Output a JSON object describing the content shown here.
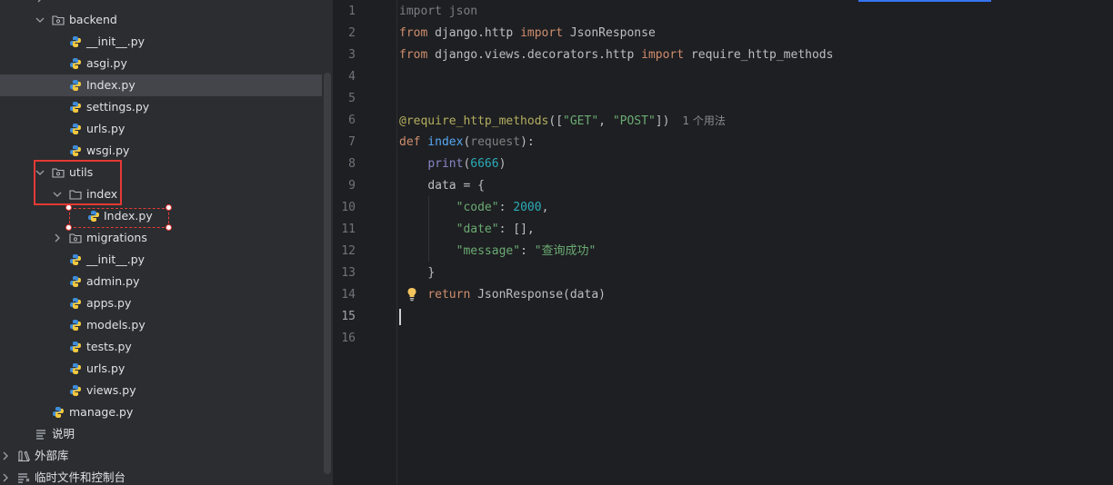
{
  "tree": {
    "items": [
      {
        "label": "backend",
        "icon": "folder-package-icon",
        "expanded": true
      },
      {
        "label": "__init__.py",
        "icon": "python-icon"
      },
      {
        "label": "asgi.py",
        "icon": "python-icon"
      },
      {
        "label": "Index.py",
        "icon": "python-icon",
        "selected": true
      },
      {
        "label": "settings.py",
        "icon": "python-icon"
      },
      {
        "label": "urls.py",
        "icon": "python-icon"
      },
      {
        "label": "wsgi.py",
        "icon": "python-icon"
      },
      {
        "label": "utils",
        "icon": "folder-package-icon",
        "expanded": true
      },
      {
        "label": "index",
        "icon": "folder-icon",
        "expanded": true
      },
      {
        "label": "Index.py",
        "icon": "python-icon"
      },
      {
        "label": "migrations",
        "icon": "folder-package-icon",
        "expanded": false
      },
      {
        "label": "__init__.py",
        "icon": "python-icon"
      },
      {
        "label": "admin.py",
        "icon": "python-icon"
      },
      {
        "label": "apps.py",
        "icon": "python-icon"
      },
      {
        "label": "models.py",
        "icon": "python-icon"
      },
      {
        "label": "tests.py",
        "icon": "python-icon"
      },
      {
        "label": "urls.py",
        "icon": "python-icon"
      },
      {
        "label": "views.py",
        "icon": "python-icon"
      },
      {
        "label": "manage.py",
        "icon": "python-icon"
      },
      {
        "label": "说明",
        "icon": "text-file-icon"
      },
      {
        "label": "外部库",
        "icon": "library-icon",
        "expanded": false
      },
      {
        "label": "临时文件和控制台",
        "icon": "scratches-icon",
        "expanded": false
      }
    ]
  },
  "editor": {
    "current_line": "15",
    "line_numbers": [
      "1",
      "2",
      "3",
      "4",
      "5",
      "6",
      "7",
      "8",
      "9",
      "10",
      "11",
      "12",
      "13",
      "14",
      "15",
      "16"
    ],
    "tokens": {
      "l1_import": "import",
      "l1_mod": " json",
      "l2_from": "from",
      "l2_mod": " django.http ",
      "l2_import": "import",
      "l2_name": " JsonResponse",
      "l3_from": "from",
      "l3_mod": " django.views.decorators.http ",
      "l3_import": "import",
      "l3_name": " require_http_methods",
      "l6_dec": "@require_http_methods",
      "l6_open": "([",
      "l6_s1": "\"GET\"",
      "l6_comma": ", ",
      "l6_s2": "\"POST\"",
      "l6_close": "])",
      "l6_hint": "1 个用法",
      "l7_def": "def",
      "l7_fn": " index",
      "l7_open": "(",
      "l7_param": "request",
      "l7_close": "):",
      "l8_print": "print",
      "l8_open": "(",
      "l8_num": "6666",
      "l8_close": ")",
      "l9_text": "data = {",
      "l10_key": "\"code\"",
      "l10_colon": ": ",
      "l10_num": "2000",
      "l10_comma": ",",
      "l11_key": "\"date\"",
      "l11_rest": ": [],",
      "l12_key": "\"message\"",
      "l12_colon": ": ",
      "l12_val": "\"查询成功\"",
      "l13_text": "}",
      "l14_return": "return",
      "l14_rest": " JsonResponse(data)"
    }
  }
}
